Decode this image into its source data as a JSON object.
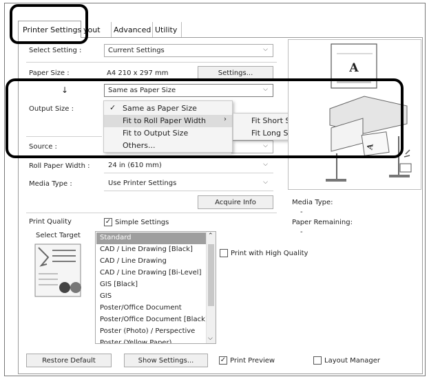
{
  "tabs": [
    {
      "label": "Printer Settings",
      "active": true
    },
    {
      "label": "yout",
      "active": false
    },
    {
      "label": "Advanced",
      "active": false
    },
    {
      "label": "Utility",
      "active": false
    }
  ],
  "form": {
    "select_setting_label": "Select Setting :",
    "select_setting_value": "Current Settings",
    "paper_size_label": "Paper Size :",
    "paper_size_value": "A4 210 x 297 mm",
    "settings_button": "Settings...",
    "arrow_symbol": "↓",
    "same_as_value": "Same as Paper Size",
    "output_size_label": "Output Size :",
    "source_label": "Source :",
    "roll_paper_width_label": "Roll Paper Width :",
    "roll_paper_width_value": "24 in (610 mm)",
    "media_type_label": "Media Type :",
    "media_type_value": "Use Printer Settings",
    "acquire_info_button": "Acquire Info",
    "print_quality_label": "Print Quality",
    "simple_settings_label": "Simple Settings",
    "simple_settings_checked": true,
    "select_target_label": "Select Target",
    "print_high_quality_label": "Print with High Quality",
    "print_high_quality_checked": false
  },
  "dropdown_menu": {
    "items": [
      {
        "label": "Same as Paper Size",
        "checked": true
      },
      {
        "label": "Fit to Roll Paper Width",
        "has_submenu": true,
        "hover": true
      },
      {
        "label": "Fit to Output Size"
      },
      {
        "label": "Others..."
      }
    ],
    "submenu": [
      {
        "label": "Fit Short Side to Roll Paper Width"
      },
      {
        "label": "Fit Long Side to Roll Paper Width"
      }
    ]
  },
  "preview": {
    "page_letter": "A",
    "media_type_label": "Media Type:",
    "media_type_value": "-",
    "paper_remaining_label": "Paper Remaining:",
    "paper_remaining_value": "-"
  },
  "target_list": {
    "items": [
      "Standard",
      "CAD / Line Drawing [Black]",
      "CAD / Line Drawing",
      "CAD / Line Drawing [Bi-Level]",
      "GIS [Black]",
      "GIS",
      "Poster/Office Document",
      "Poster/Office Document [Black]",
      "Poster (Photo) / Perspective",
      "Poster (Yellow Paper)"
    ],
    "selected_index": 0
  },
  "footer": {
    "restore_default": "Restore Default",
    "show_settings": "Show Settings...",
    "print_preview_label": "Print Preview",
    "print_preview_checked": true,
    "layout_manager_label": "Layout Manager",
    "layout_manager_checked": false
  },
  "glyphs": {
    "chevron_down": "⌵",
    "chevron_up": "⌃",
    "chevron_right": "›",
    "check": "✓"
  }
}
